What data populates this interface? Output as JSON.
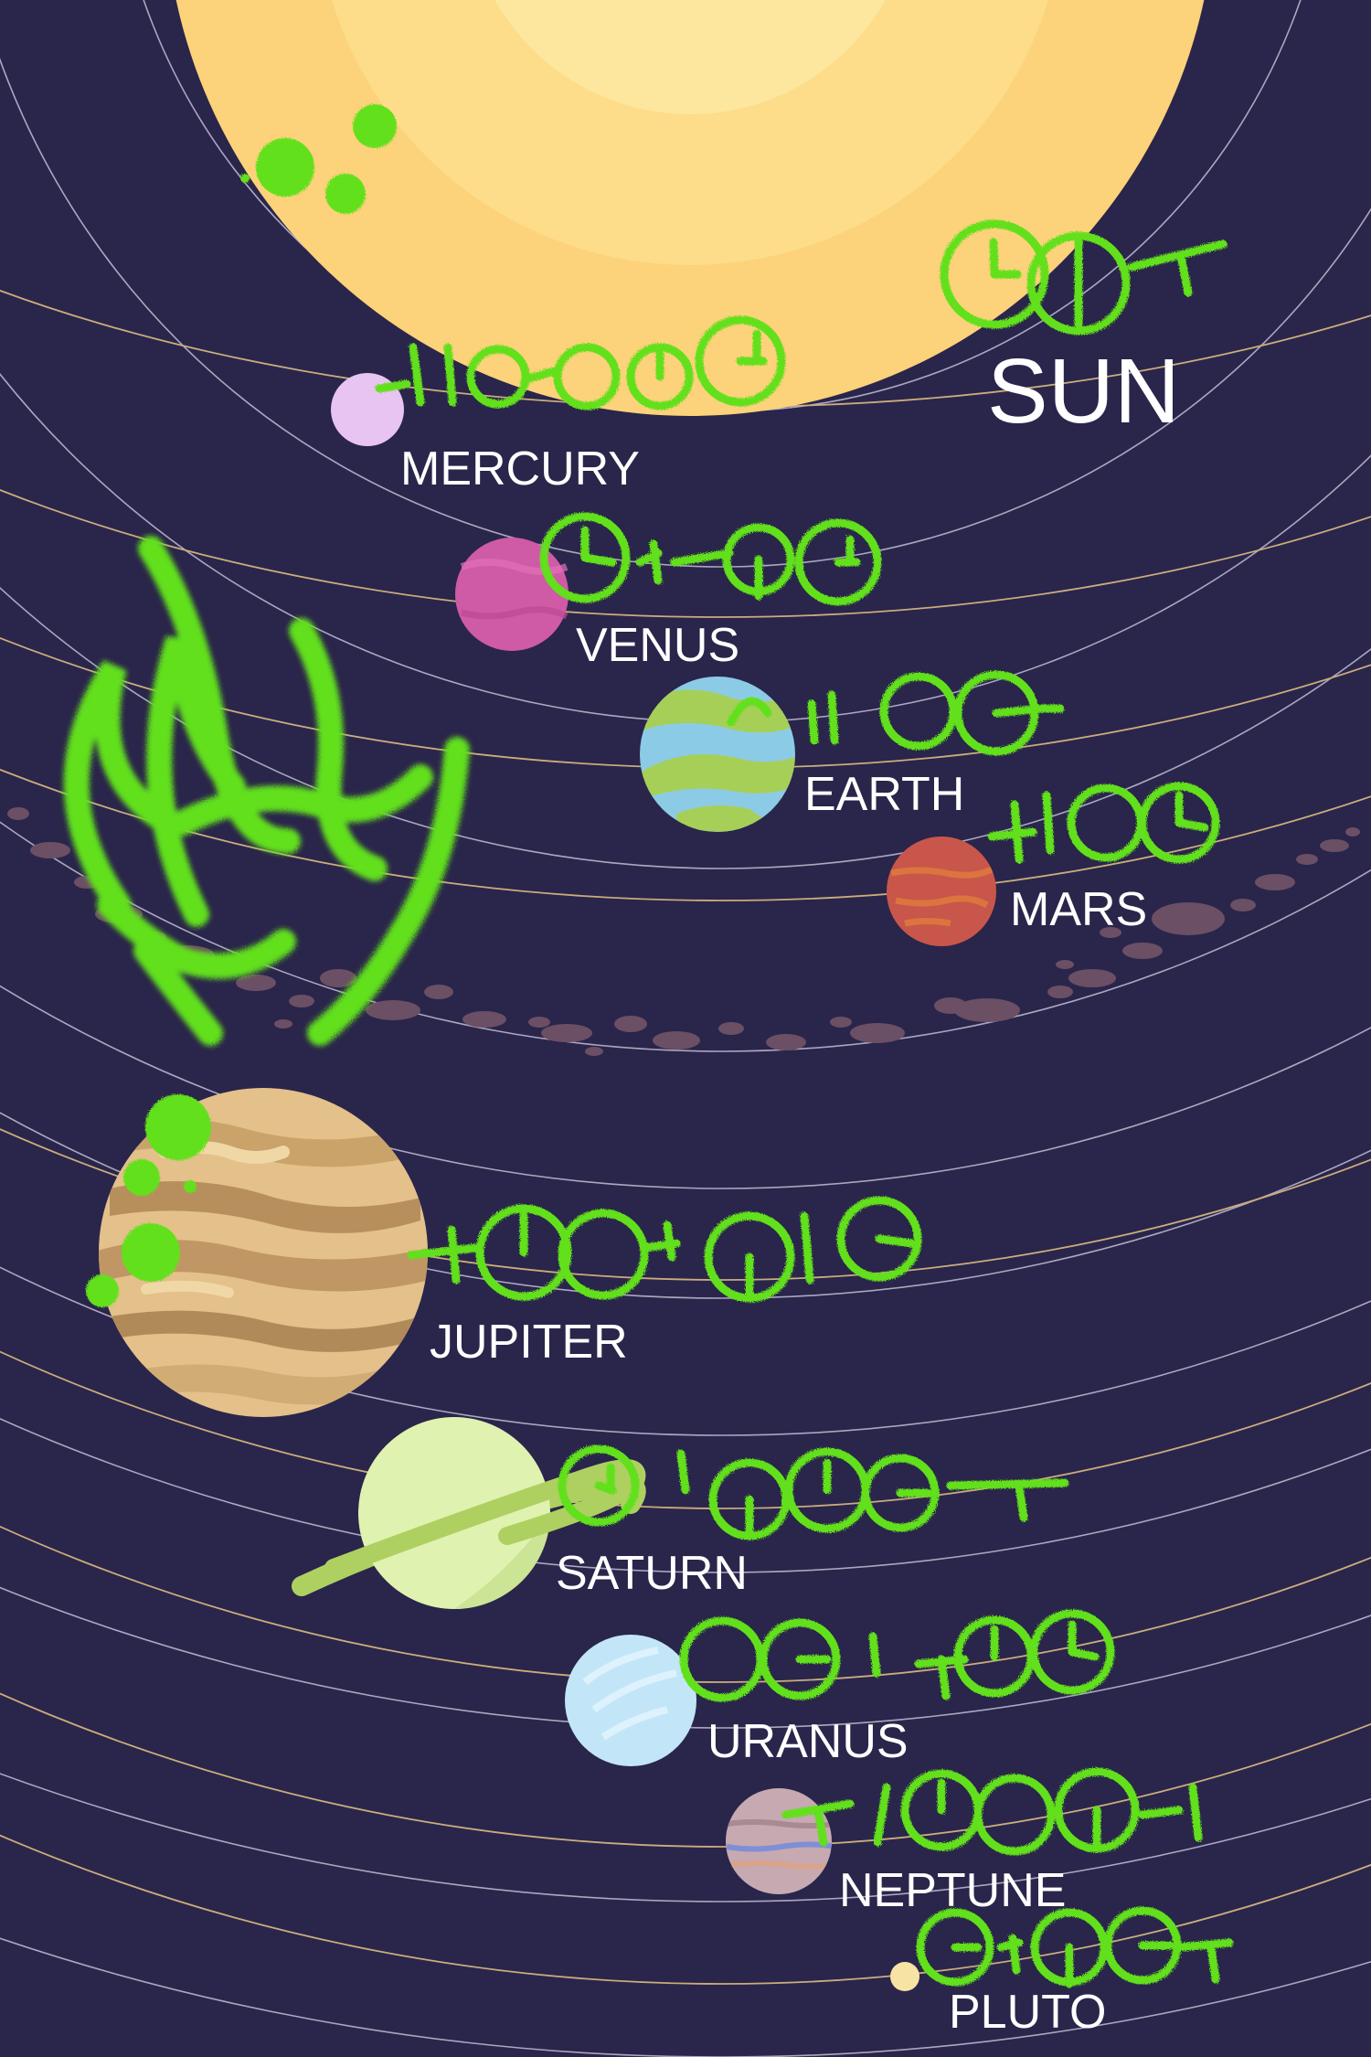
{
  "sun_label": "SUN",
  "planets": [
    {
      "name": "MERCURY",
      "color": "#e8c4f2"
    },
    {
      "name": "VENUS",
      "color": "#cf5aa6"
    },
    {
      "name": "EARTH",
      "color": "#8ccbe6"
    },
    {
      "name": "MARS",
      "color": "#c9564a"
    },
    {
      "name": "JUPITER",
      "color": "#e4c08a"
    },
    {
      "name": "SATURN",
      "color": "#dff2b0"
    },
    {
      "name": "URANUS",
      "color": "#c2e6f7"
    },
    {
      "name": "NEPTUNE",
      "color": "#c7a9b2"
    },
    {
      "name": "PLUTO",
      "color": "#f7e3a3"
    }
  ],
  "colors": {
    "background": "#2a254b",
    "sun_outer": "#fcd27a",
    "sun_inner": "#fde79f",
    "orbit_white": "#d6d3e6",
    "orbit_gold": "#c9ad7c",
    "asteroid": "#6b4f64",
    "graffiti_green": "#62e01c"
  }
}
